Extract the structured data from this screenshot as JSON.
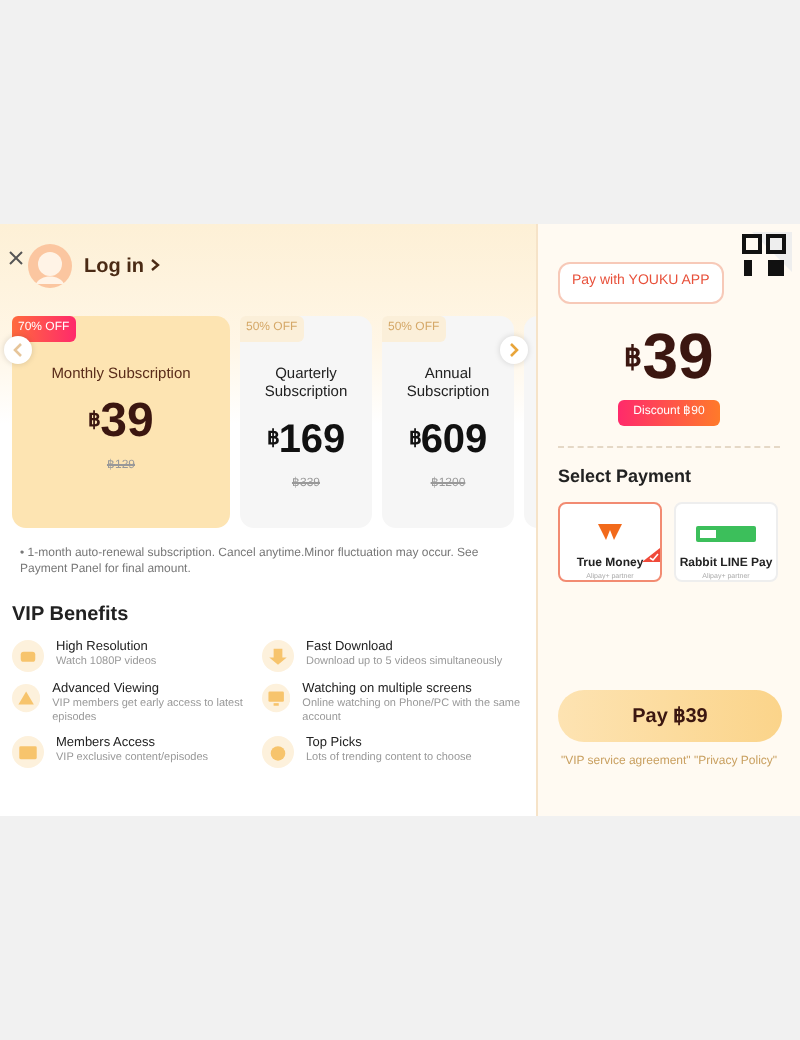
{
  "login": {
    "label": "Log in"
  },
  "plans": [
    {
      "discount": "70% OFF",
      "name": "Monthly Subscription",
      "currency": "฿",
      "price": "39",
      "original": "฿129",
      "selected": true
    },
    {
      "discount": "50% OFF",
      "name": "Quarterly Subscription",
      "currency": "฿",
      "price": "169",
      "original": "฿339",
      "selected": false
    },
    {
      "discount": "50% OFF",
      "name": "Annual Subscription",
      "currency": "฿",
      "price": "609",
      "original": "฿1200",
      "selected": false
    }
  ],
  "note": "• 1-month auto-renewal subscription. Cancel anytime.Minor fluctuation may occur. See Payment Panel for final amount.",
  "benefits_title": "VIP Benefits",
  "benefits": [
    {
      "title": "High Resolution",
      "description": "Watch 1080P videos"
    },
    {
      "title": "Fast Download",
      "description": "Download up to 5 videos simultaneously"
    },
    {
      "title": "Advanced Viewing",
      "description": "VIP members get early access to latest episodes"
    },
    {
      "title": "Watching on multiple screens",
      "description": "Online watching on Phone/PC with the same account"
    },
    {
      "title": "Members Access",
      "description": "VIP exclusive content/episodes"
    },
    {
      "title": "Top Picks",
      "description": "Lots of trending content to choose"
    }
  ],
  "checkout": {
    "app_button": "Pay with YOUKU APP",
    "currency": "฿",
    "price": "39",
    "discount": "Discount ฿90",
    "section_title": "Select Payment",
    "methods": [
      {
        "name": "True Money",
        "subtitle": "Alipay+ partner",
        "selected": true
      },
      {
        "name": "Rabbit LINE Pay",
        "subtitle": "Alipay+ partner",
        "selected": false
      }
    ],
    "pay_button": "Pay ฿39",
    "agreement": "\"VIP service agreement\" \"Privacy Policy\""
  }
}
